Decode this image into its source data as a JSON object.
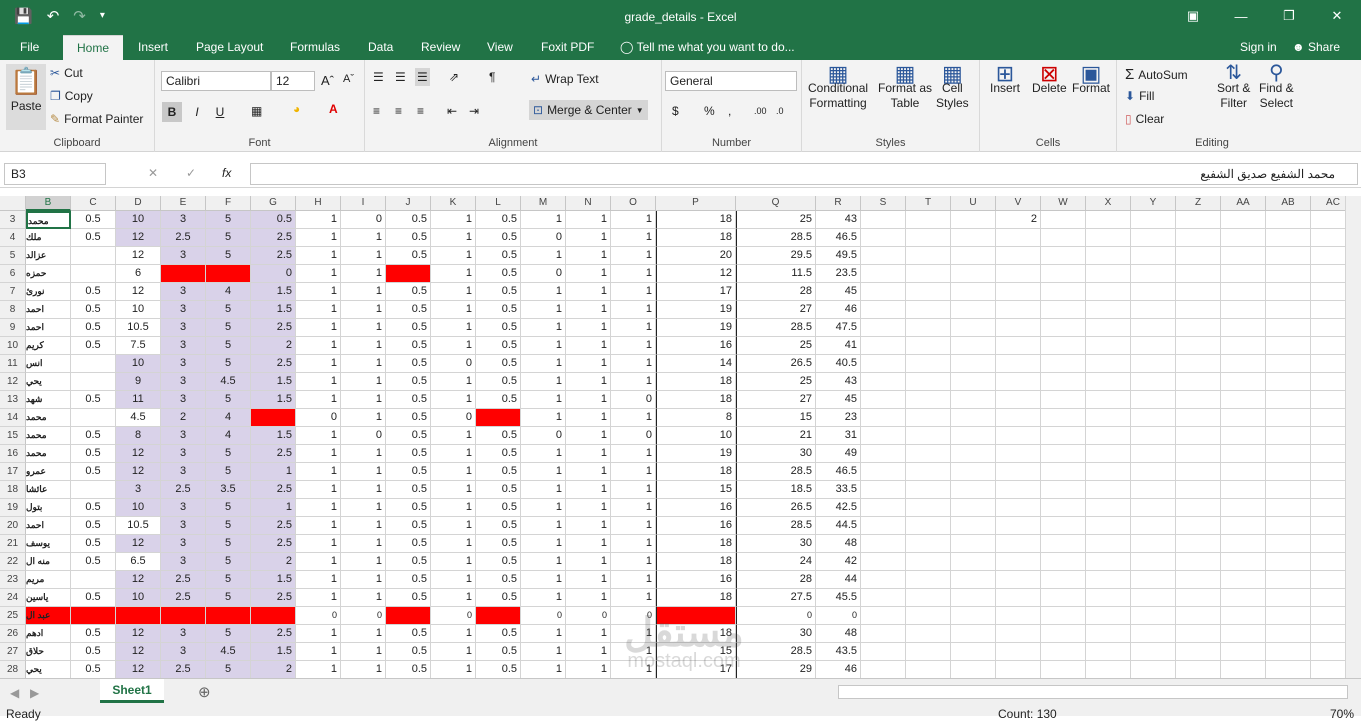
{
  "window": {
    "title": "grade_details - Excel",
    "qat": {
      "save": "save-icon",
      "undo": "undo-icon",
      "redo": "redo-icon"
    }
  },
  "tabs": [
    "File",
    "Home",
    "Insert",
    "Page Layout",
    "Formulas",
    "Data",
    "Review",
    "View",
    "Foxit PDF"
  ],
  "tell_me": "Tell me what you want to do...",
  "sign_in": "Sign in",
  "share": "Share",
  "ribbon": {
    "clipboard": {
      "label": "Clipboard",
      "paste": "Paste",
      "cut": "Cut",
      "copy": "Copy",
      "format_painter": "Format Painter"
    },
    "font": {
      "label": "Font",
      "name": "Calibri",
      "size": "12",
      "bold": "B",
      "italic": "I",
      "underline": "U"
    },
    "alignment": {
      "label": "Alignment",
      "wrap": "Wrap Text",
      "merge": "Merge & Center"
    },
    "number": {
      "label": "Number",
      "format": "General",
      "currency": "$",
      "percent": "%",
      "comma": ","
    },
    "styles": {
      "label": "Styles",
      "cond": "Conditional",
      "cond2": "Formatting",
      "fmt_table": "Format as",
      "fmt_table2": "Table",
      "cell_styles": "Cell",
      "cell_styles2": "Styles"
    },
    "cells": {
      "label": "Cells",
      "insert": "Insert",
      "delete": "Delete",
      "format": "Format"
    },
    "editing": {
      "label": "Editing",
      "autosum": "AutoSum",
      "fill": "Fill",
      "clear": "Clear",
      "sort": "Sort &",
      "sort2": "Filter",
      "find": "Find &",
      "find2": "Select"
    }
  },
  "formula_bar": {
    "name_box": "B3",
    "fx": "fx",
    "value": "محمد الشفيع صديق الشفيع"
  },
  "columns": [
    "B",
    "C",
    "D",
    "E",
    "F",
    "G",
    "H",
    "I",
    "J",
    "K",
    "L",
    "M",
    "N",
    "O",
    "P",
    "Q",
    "R",
    "S",
    "T",
    "U",
    "V",
    "W",
    "X",
    "Y",
    "Z",
    "AA",
    "AB",
    "AC"
  ],
  "rows": [
    {
      "n": "3",
      "b": "محمد",
      "v": [
        "0.5",
        "10",
        "3",
        "5",
        "0.5",
        "1",
        "0",
        "0.5",
        "1",
        "0.5",
        "1",
        "1",
        "1",
        "18",
        "25",
        "43"
      ]
    },
    {
      "n": "4",
      "b": "ملك",
      "v": [
        "0.5",
        "12",
        "2.5",
        "5",
        "2.5",
        "1",
        "1",
        "0.5",
        "1",
        "0.5",
        "0",
        "1",
        "1",
        "18",
        "28.5",
        "46.5"
      ]
    },
    {
      "n": "5",
      "b": "عزالد",
      "v": [
        "",
        "12",
        "3",
        "5",
        "2.5",
        "1",
        "1",
        "0.5",
        "1",
        "0.5",
        "1",
        "1",
        "1",
        "20",
        "29.5",
        "49.5"
      ]
    },
    {
      "n": "6",
      "b": "حمزه",
      "v": [
        "",
        "6",
        "",
        "",
        "0",
        "1",
        "1",
        "",
        "1",
        "0.5",
        "0",
        "1",
        "1",
        "12",
        "11.5",
        "23.5"
      ]
    },
    {
      "n": "7",
      "b": "نورئ",
      "v": [
        "0.5",
        "12",
        "3",
        "4",
        "1.5",
        "1",
        "1",
        "0.5",
        "1",
        "0.5",
        "1",
        "1",
        "1",
        "17",
        "28",
        "45"
      ]
    },
    {
      "n": "8",
      "b": "احمد",
      "v": [
        "0.5",
        "10",
        "3",
        "5",
        "1.5",
        "1",
        "1",
        "0.5",
        "1",
        "0.5",
        "1",
        "1",
        "1",
        "19",
        "27",
        "46"
      ]
    },
    {
      "n": "9",
      "b": "احمد",
      "v": [
        "0.5",
        "10.5",
        "3",
        "5",
        "2.5",
        "1",
        "1",
        "0.5",
        "1",
        "0.5",
        "1",
        "1",
        "1",
        "19",
        "28.5",
        "47.5"
      ]
    },
    {
      "n": "10",
      "b": "كريم",
      "v": [
        "0.5",
        "7.5",
        "3",
        "5",
        "2",
        "1",
        "1",
        "0.5",
        "1",
        "0.5",
        "1",
        "1",
        "1",
        "16",
        "25",
        "41"
      ]
    },
    {
      "n": "11",
      "b": "انس",
      "v": [
        "",
        "10",
        "3",
        "5",
        "2.5",
        "1",
        "1",
        "0.5",
        "0",
        "0.5",
        "1",
        "1",
        "1",
        "14",
        "26.5",
        "40.5"
      ]
    },
    {
      "n": "12",
      "b": "يحي",
      "v": [
        "",
        "9",
        "3",
        "4.5",
        "1.5",
        "1",
        "1",
        "0.5",
        "1",
        "0.5",
        "1",
        "1",
        "1",
        "18",
        "25",
        "43"
      ]
    },
    {
      "n": "13",
      "b": "شهد",
      "v": [
        "0.5",
        "11",
        "3",
        "5",
        "1.5",
        "1",
        "1",
        "0.5",
        "1",
        "0.5",
        "1",
        "1",
        "0",
        "18",
        "27",
        "45"
      ]
    },
    {
      "n": "14",
      "b": "محمد",
      "v": [
        "",
        "4.5",
        "2",
        "4",
        "",
        "0",
        "1",
        "0.5",
        "0",
        "",
        "1",
        "1",
        "1",
        "8",
        "15",
        "23"
      ]
    },
    {
      "n": "15",
      "b": "محمد",
      "v": [
        "0.5",
        "8",
        "3",
        "4",
        "1.5",
        "1",
        "0",
        "0.5",
        "1",
        "0.5",
        "0",
        "1",
        "0",
        "10",
        "21",
        "31"
      ]
    },
    {
      "n": "16",
      "b": "محمد",
      "v": [
        "0.5",
        "12",
        "3",
        "5",
        "2.5",
        "1",
        "1",
        "0.5",
        "1",
        "0.5",
        "1",
        "1",
        "1",
        "19",
        "30",
        "49"
      ]
    },
    {
      "n": "17",
      "b": "عمرو",
      "v": [
        "0.5",
        "12",
        "3",
        "5",
        "1",
        "1",
        "1",
        "0.5",
        "1",
        "0.5",
        "1",
        "1",
        "1",
        "18",
        "28.5",
        "46.5"
      ]
    },
    {
      "n": "18",
      "b": "عائشا",
      "v": [
        "",
        "3",
        "2.5",
        "3.5",
        "2.5",
        "1",
        "1",
        "0.5",
        "1",
        "0.5",
        "1",
        "1",
        "1",
        "15",
        "18.5",
        "33.5"
      ]
    },
    {
      "n": "19",
      "b": "بتول",
      "v": [
        "0.5",
        "10",
        "3",
        "5",
        "1",
        "1",
        "1",
        "0.5",
        "1",
        "0.5",
        "1",
        "1",
        "1",
        "16",
        "26.5",
        "42.5"
      ]
    },
    {
      "n": "20",
      "b": "احمد",
      "v": [
        "0.5",
        "10.5",
        "3",
        "5",
        "2.5",
        "1",
        "1",
        "0.5",
        "1",
        "0.5",
        "1",
        "1",
        "1",
        "16",
        "28.5",
        "44.5"
      ]
    },
    {
      "n": "21",
      "b": "يوسف",
      "v": [
        "0.5",
        "12",
        "3",
        "5",
        "2.5",
        "1",
        "1",
        "0.5",
        "1",
        "0.5",
        "1",
        "1",
        "1",
        "18",
        "30",
        "48"
      ]
    },
    {
      "n": "22",
      "b": "منه ال",
      "v": [
        "0.5",
        "6.5",
        "3",
        "5",
        "2",
        "1",
        "1",
        "0.5",
        "1",
        "0.5",
        "1",
        "1",
        "1",
        "18",
        "24",
        "42"
      ]
    },
    {
      "n": "23",
      "b": "مريم",
      "v": [
        "",
        "12",
        "2.5",
        "5",
        "1.5",
        "1",
        "1",
        "0.5",
        "1",
        "0.5",
        "1",
        "1",
        "1",
        "16",
        "28",
        "44"
      ]
    },
    {
      "n": "24",
      "b": "ياسين",
      "v": [
        "0.5",
        "10",
        "2.5",
        "5",
        "2.5",
        "1",
        "1",
        "0.5",
        "1",
        "0.5",
        "1",
        "1",
        "1",
        "18",
        "27.5",
        "45.5"
      ]
    },
    {
      "n": "25",
      "b": "عبد ال",
      "v": [
        "",
        "",
        "",
        "",
        "",
        "0",
        "0",
        "",
        "0",
        "",
        "0",
        "0",
        "0",
        "",
        "0",
        "0"
      ]
    },
    {
      "n": "26",
      "b": "ادهم",
      "v": [
        "0.5",
        "12",
        "3",
        "5",
        "2.5",
        "1",
        "1",
        "0.5",
        "1",
        "0.5",
        "1",
        "1",
        "1",
        "18",
        "30",
        "48"
      ]
    },
    {
      "n": "27",
      "b": "حلاق",
      "v": [
        "0.5",
        "12",
        "3",
        "4.5",
        "1.5",
        "1",
        "1",
        "0.5",
        "1",
        "0.5",
        "1",
        "1",
        "1",
        "15",
        "28.5",
        "43.5"
      ]
    },
    {
      "n": "28",
      "b": "يحي",
      "v": [
        "0.5",
        "12",
        "2.5",
        "5",
        "2",
        "1",
        "1",
        "0.5",
        "1",
        "0.5",
        "1",
        "1",
        "1",
        "17",
        "29",
        "46"
      ]
    }
  ],
  "extra_cell": {
    "col": "V",
    "row": "3",
    "value": "2"
  },
  "sheet": {
    "tab": "Sheet1"
  },
  "status": {
    "ready": "Ready",
    "count": "Count: 130",
    "zoom": "70%"
  },
  "watermark": {
    "ar": "مستقل",
    "en": "mostaql.com"
  },
  "colors": {
    "green": "#217346",
    "purple": "#d9d2e9",
    "red": "#ff0000"
  }
}
